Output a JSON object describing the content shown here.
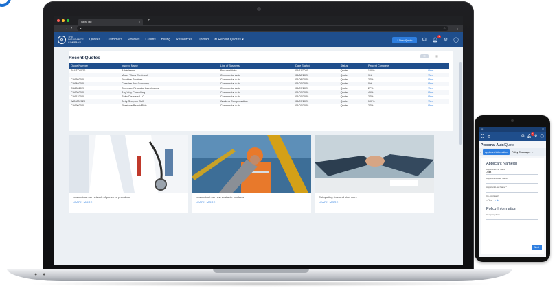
{
  "browser": {
    "tab_title": "New Tab",
    "tab_close": "×",
    "tab_add": "+"
  },
  "app": {
    "logo_mark": "⊙",
    "logo_line1": "THE",
    "logo_line2": "INSURANCE",
    "logo_line3": "COMPANY",
    "nav_items": [
      "Quotes",
      "Customers",
      "Policies",
      "Claims",
      "Billing",
      "Resources",
      "Upload",
      "Recent Quotes"
    ],
    "new_quote_label": "+ New Quote",
    "notification_count": "3"
  },
  "recent_quotes": {
    "title": "Recent Quotes",
    "columns": [
      "Quote Number",
      "Insured Name",
      "Line of Business",
      "Date Started",
      "Status",
      "Percent Complete",
      ""
    ],
    "rows": [
      [
        "PAUTO2020",
        "Adcis Kenn",
        "Personal Auto",
        "05/11/2020",
        "Quote",
        "100%",
        "View"
      ],
      [
        "",
        "Mister Wees Electrical",
        "Commercial Auto",
        "05/08/2020",
        "Quote",
        "9%",
        "View"
      ],
      [
        "CA6302020",
        "Frontline Services",
        "Commercial Auto",
        "05/08/2020",
        "Quote",
        "27%",
        "View"
      ],
      [
        "CA6402020",
        "Christine And Company",
        "Commercial Auto",
        "05/07/2020",
        "Quote",
        "0%",
        "View"
      ],
      [
        "CA6802020",
        "Sorenson Financial Investments",
        "Commercial Auto",
        "05/07/2020",
        "Quote",
        "27%",
        "View"
      ],
      [
        "CA6202020",
        "Bay Way Consulting",
        "Commercial Auto",
        "05/07/2020",
        "Quote",
        "45%",
        "View"
      ],
      [
        "CA6122020",
        "Palm Cleaners LLC",
        "Commercial Auto",
        "05/07/2020",
        "Quote",
        "27%",
        "View"
      ],
      [
        "WC6002020",
        "Betty Shop on Gulf",
        "Workers Compensation",
        "05/07/2020",
        "Quote",
        "100%",
        "View"
      ],
      [
        "CA6902020",
        "Firestone Beach Ride",
        "Commercial Auto",
        "05/07/2020",
        "Quote",
        "27%",
        "View"
      ]
    ]
  },
  "tiles": [
    {
      "text": "Learn about our network of preferred providers",
      "link": "LEARN MORE"
    },
    {
      "text": "Learn about our new available products",
      "link": "LEARN MORE"
    },
    {
      "text": "Cut quoting time and bind more",
      "link": "LEARN MORE"
    }
  ],
  "phone": {
    "page_title": "Personal Auto",
    "page_subtitle": "/Quote",
    "tab_active": "Applicant Information",
    "tab_next": "Policy Coverages",
    "section1": "Applicant Name(s)",
    "first_name_label": "Applicant First Name *",
    "first_name_value": "Julia",
    "middle_name_label": "Applicant Middle Name",
    "last_name_label": "Applicant Last Name *",
    "co_applicant_label": "Co-Applicant?",
    "yes_label": "Yes",
    "no_label": "No",
    "section2": "Policy Information",
    "company_plan_label": "Company Plan",
    "next_label": "Next"
  },
  "colors": {
    "nav_blue": "#1f4e8c",
    "accent_blue": "#2f7fe0",
    "badge_red": "#e63434"
  }
}
